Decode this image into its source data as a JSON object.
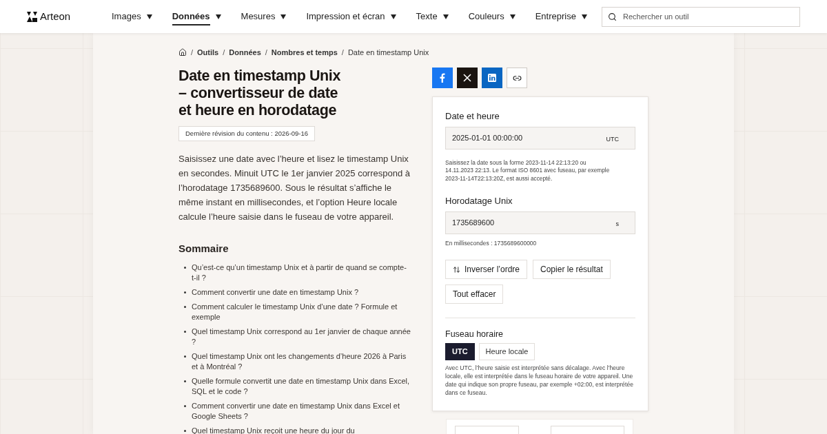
{
  "header": {
    "logo": "Arteon",
    "nav": [
      {
        "label": "Images",
        "selected": false
      },
      {
        "label": "Données",
        "selected": true
      },
      {
        "label": "Mesures",
        "selected": false
      },
      {
        "label": "Impression et écran",
        "selected": false
      },
      {
        "label": "Texte",
        "selected": false
      },
      {
        "label": "Couleurs",
        "selected": false
      },
      {
        "label": "Entreprise",
        "selected": false
      }
    ],
    "search": {
      "placeholder": "Rechercher un outil"
    }
  },
  "breadcrumb": {
    "separator": "/",
    "items": [
      {
        "label": "Outils",
        "kind": "link"
      },
      {
        "label": "Données",
        "kind": "link"
      },
      {
        "label": "Nombres et temps",
        "kind": "link"
      },
      {
        "label": "Date en timestamp Unix",
        "kind": "current"
      }
    ]
  },
  "title_lines": [
    "Date en timestamp Unix",
    "– convertisseur de date",
    "et heure en horodatage"
  ],
  "revision": "Dernière révision du contenu : 2026-09-16",
  "intro": "Saisissez une date avec l’heure et lisez le timestamp Unix en secondes. Minuit UTC le 1er janvier 2025 correspond à l’horodatage 1735689600. Sous le résultat s’affiche le même instant en millisecondes, et l’option Heure locale calcule l’heure saisie dans le fuseau de votre appareil.",
  "toc": {
    "heading": "Sommaire",
    "items": [
      "Qu’est-ce qu’un timestamp Unix et à partir de quand se compte-t-il ?",
      "Comment convertir une date en timestamp Unix ?",
      "Comment calculer le timestamp Unix d’une date ? Formule et exemple",
      "Quel timestamp Unix correspond au 1er janvier de chaque année ?",
      "Quel timestamp Unix ont les changements d’heure 2026 à Paris et à Montréal ?",
      "Quelle formule convertit une date en timestamp Unix dans Excel, SQL et le code ?",
      "Comment convertir une date en timestamp Unix dans Excel et Google Sheets ?",
      "Quel timestamp Unix reçoit une heure du jour du"
    ]
  },
  "share": [
    {
      "kind": "facebook"
    },
    {
      "kind": "x"
    },
    {
      "kind": "linkedin"
    },
    {
      "kind": "link"
    }
  ],
  "tool": {
    "date_field": {
      "label": "Date et heure",
      "value": "2025-01-01 00:00:00",
      "suffix": "UTC"
    },
    "date_hint": "Saisissez la date sous la forme 2023-11-14 22:13:20 ou 14.11.2023 22:13. Le format ISO 8601 avec fuseau, par exemple 2023-11-14T22:13:20Z, est aussi accepté.",
    "unix_field": {
      "label": "Horodatage Unix",
      "value": "1735689600",
      "suffix": "s"
    },
    "ms_note": "En millisecondes : 1735689600000",
    "buttons": [
      {
        "label": "Inverser l’ordre",
        "kind": "swap"
      },
      {
        "label": "Copier le résultat",
        "kind": "plain"
      },
      {
        "label": "Tout effacer",
        "kind": "plain"
      }
    ],
    "timezone": {
      "label": "Fuseau horaire",
      "options": [
        {
          "label": "UTC",
          "selected": true
        },
        {
          "label": "Heure locale",
          "selected": false
        }
      ],
      "note": "Avec UTC, l’heure saisie est interprétée sans décalage. Avec l’heure locale, elle est interprétée dans le fuseau horaire de votre appareil. Une date qui indique son propre fuseau, par exemple +02:00, est interprétée dans ce fuseau."
    }
  }
}
